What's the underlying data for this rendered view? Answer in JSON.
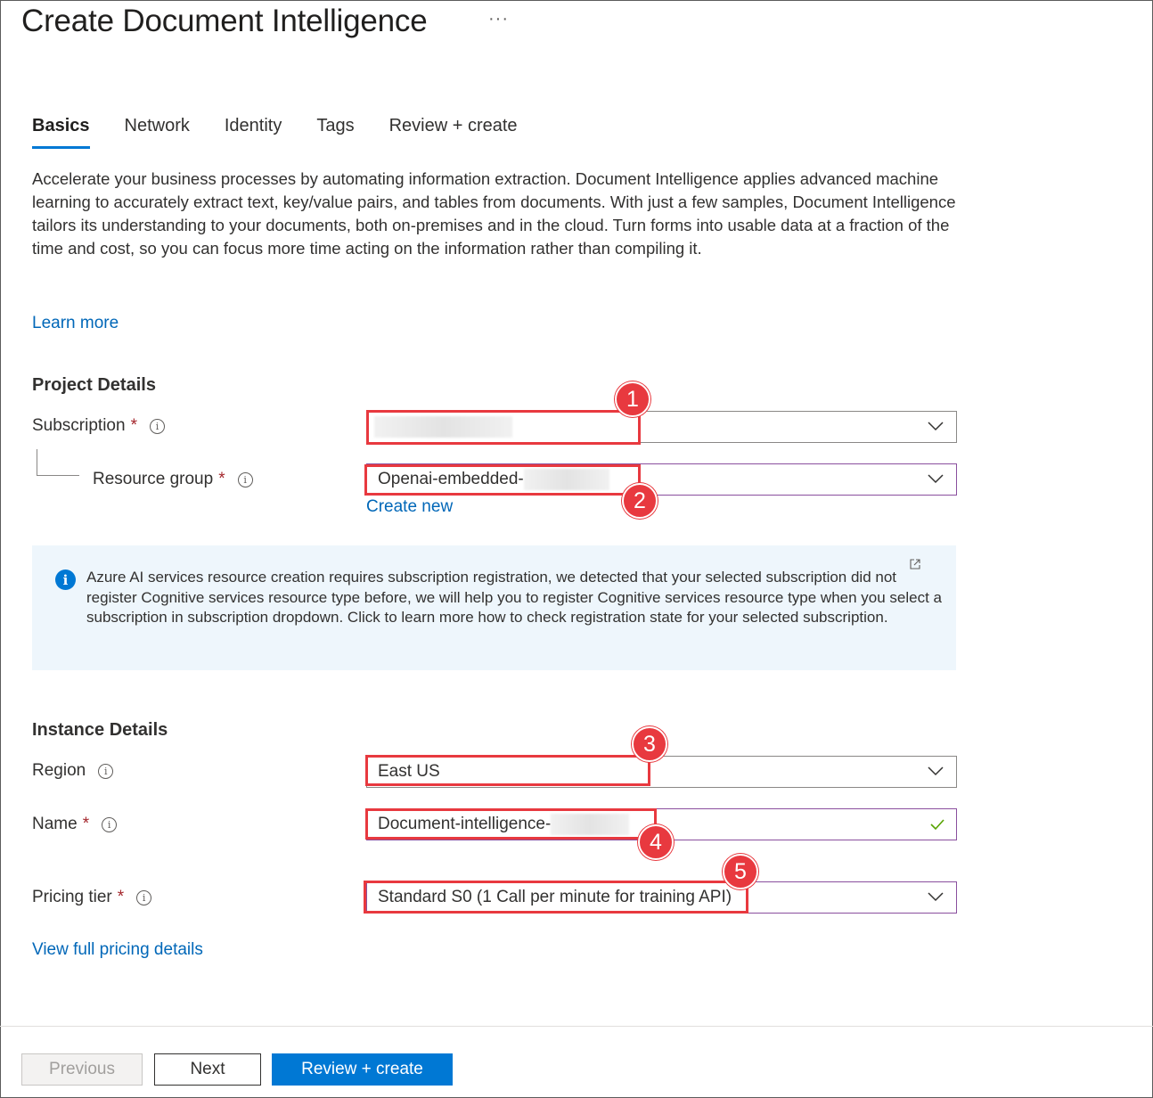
{
  "header": {
    "title": "Create Document Intelligence",
    "more": "···"
  },
  "tabs": [
    {
      "label": "Basics",
      "active": true
    },
    {
      "label": "Network"
    },
    {
      "label": "Identity"
    },
    {
      "label": "Tags"
    },
    {
      "label": "Review + create"
    }
  ],
  "description": "Accelerate your business processes by automating information extraction. Document Intelligence applies advanced machine learning to accurately extract text, key/value pairs, and tables from documents. With just a few samples, Document Intelligence tailors its understanding to your documents, both on-premises and in the cloud. Turn forms into usable data at a fraction of the time and cost, so you can focus more time acting on the information rather than compiling it.",
  "learn_more": "Learn more",
  "project_details": {
    "title": "Project Details",
    "subscription_label": "Subscription",
    "resource_group_label": "Resource group",
    "resource_group_value": "Openai-embedded-",
    "create_new": "Create new",
    "required_mark": "*"
  },
  "info_banner": {
    "text": "Azure AI services resource creation requires subscription registration, we detected that your selected subscription did not register Cognitive services resource type before, we will help you to register Cognitive services resource type when you select a subscription in subscription dropdown. Click to learn more how to check registration state for your selected subscription."
  },
  "instance_details": {
    "title": "Instance Details",
    "region_label": "Region",
    "region_value": "East US",
    "name_label": "Name",
    "name_value": "Document-intelligence-",
    "pricing_label": "Pricing tier",
    "pricing_value": "Standard S0 (1 Call per minute for training API)",
    "pricing_link": "View full pricing details"
  },
  "markers": [
    "1",
    "2",
    "3",
    "4",
    "5"
  ],
  "footer": {
    "previous": "Previous",
    "next": "Next",
    "review_create": "Review + create"
  },
  "colors": {
    "accent": "#0078d4",
    "annotation_red": "#e8393f",
    "required_red": "#a4262c",
    "info_bg": "#eef6fc"
  }
}
